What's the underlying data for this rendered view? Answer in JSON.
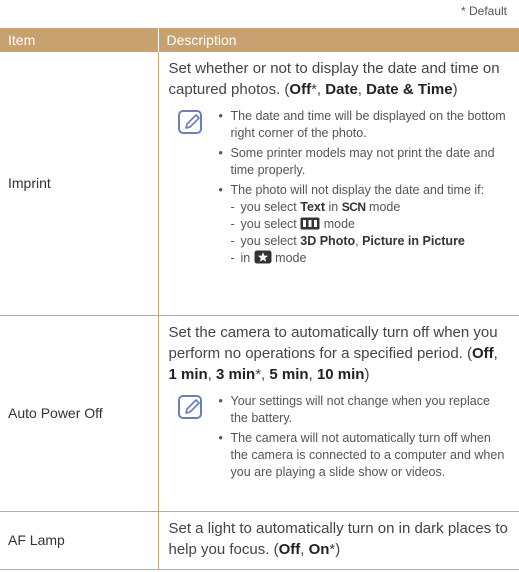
{
  "default_note": "* Default",
  "header": {
    "item": "Item",
    "description": "Description"
  },
  "imprint": {
    "label": "Imprint",
    "lead": "Set whether or not to display the date and time on captured photos. (",
    "opt1": "Off",
    "opt1_suffix": "*, ",
    "opt2": "Date",
    "sep2": ", ",
    "opt3": "Date & Time",
    "close": ")",
    "note1": "The date and time will be displayed on the bottom right corner of the photo.",
    "note2": "Some printer models may not print the date and time properly.",
    "note3": "The photo will not display the date and time if:",
    "sub1_pre": "you select ",
    "sub1_bold": "Text",
    "sub1_mid": " in ",
    "sub1_scn": "SCN",
    "sub1_post": " mode",
    "sub2_pre": "you select ",
    "sub2_post": " mode",
    "sub3_pre": "you select ",
    "sub3_bold1": "3D Photo",
    "sub3_sep": ", ",
    "sub3_bold2": "Picture in Picture",
    "sub3_in": "in ",
    "sub3_post": " mode"
  },
  "auto_power": {
    "label": "Auto Power Off",
    "lead": "Set the camera to automatically turn off when you perform no operations for a specified period. (",
    "o1": "Off",
    "s1": ", ",
    "o2": "1 min",
    "s2": ", ",
    "o3": "3 min",
    "s3": "*, ",
    "o4": "5 min",
    "s4": ", ",
    "o5": "10 min",
    "close": ")",
    "note1": "Your settings will not change when you replace the battery.",
    "note2": "The camera will not automatically turn off when the camera is connected to a computer and when you are playing a slide show or videos."
  },
  "af_lamp": {
    "label": "AF Lamp",
    "lead": "Set a light to automatically turn on in dark places to help you focus. (",
    "o1": "Off",
    "s1": ", ",
    "o2": "On",
    "s2": "*)"
  },
  "colors": {
    "header_bg": "#c7a16f",
    "rule": "#c9a878",
    "icon_border": "#6d7fb8"
  },
  "icons": {
    "note": "note-pencil-icon",
    "panorama": "panorama-mode-icon",
    "magic": "magic-star-mode-icon"
  }
}
